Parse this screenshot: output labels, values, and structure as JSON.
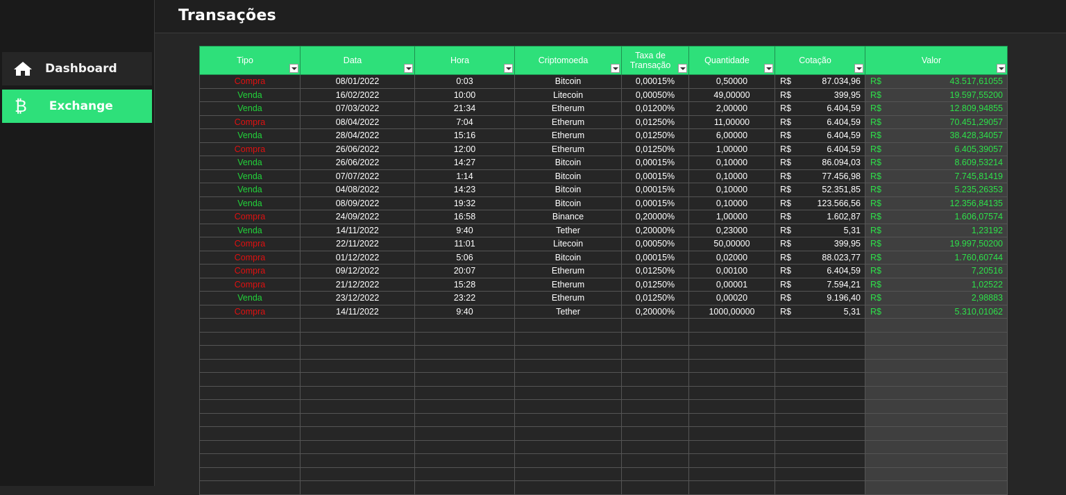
{
  "header": {
    "title": "Transações"
  },
  "sidebar": {
    "items": [
      {
        "label": "Dashboard",
        "icon": "home-icon",
        "active": false
      },
      {
        "label": "Exchange",
        "icon": "bitcoin-icon",
        "active": true
      }
    ]
  },
  "colors": {
    "accent": "#2ee07a",
    "compra": "#e01010",
    "venda": "#22d33a"
  },
  "table": {
    "columns": [
      {
        "key": "tipo",
        "label": "Tipo",
        "filter": true
      },
      {
        "key": "data",
        "label": "Data",
        "filter": true
      },
      {
        "key": "hora",
        "label": "Hora",
        "filter": true
      },
      {
        "key": "cripto",
        "label": "Criptomoeda",
        "filter": true
      },
      {
        "key": "taxa",
        "label": "Taxa de Transação",
        "filter": true
      },
      {
        "key": "qtd",
        "label": "Quantidade",
        "filter": true
      },
      {
        "key": "cotacao",
        "label": "Cotação",
        "filter": true
      },
      {
        "key": "valor",
        "label": "Valor",
        "filter": true
      }
    ],
    "currency": "R$",
    "rows": [
      {
        "tipo": "Compra",
        "data": "08/01/2022",
        "hora": "0:03",
        "cripto": "Bitcoin",
        "taxa": "0,00015%",
        "qtd": "0,50000",
        "cotacao": "87.034,96",
        "valor": "43.517,61055"
      },
      {
        "tipo": "Venda",
        "data": "16/02/2022",
        "hora": "10:00",
        "cripto": "Litecoin",
        "taxa": "0,00050%",
        "qtd": "49,00000",
        "cotacao": "399,95",
        "valor": "19.597,55200"
      },
      {
        "tipo": "Venda",
        "data": "07/03/2022",
        "hora": "21:34",
        "cripto": "Etherum",
        "taxa": "0,01200%",
        "qtd": "2,00000",
        "cotacao": "6.404,59",
        "valor": "12.809,94855"
      },
      {
        "tipo": "Compra",
        "data": "08/04/2022",
        "hora": "7:04",
        "cripto": "Etherum",
        "taxa": "0,01250%",
        "qtd": "11,00000",
        "cotacao": "6.404,59",
        "valor": "70.451,29057"
      },
      {
        "tipo": "Venda",
        "data": "28/04/2022",
        "hora": "15:16",
        "cripto": "Etherum",
        "taxa": "0,01250%",
        "qtd": "6,00000",
        "cotacao": "6.404,59",
        "valor": "38.428,34057"
      },
      {
        "tipo": "Compra",
        "data": "26/06/2022",
        "hora": "12:00",
        "cripto": "Etherum",
        "taxa": "0,01250%",
        "qtd": "1,00000",
        "cotacao": "6.404,59",
        "valor": "6.405,39057"
      },
      {
        "tipo": "Venda",
        "data": "26/06/2022",
        "hora": "14:27",
        "cripto": "Bitcoin",
        "taxa": "0,00015%",
        "qtd": "0,10000",
        "cotacao": "86.094,03",
        "valor": "8.609,53214"
      },
      {
        "tipo": "Venda",
        "data": "07/07/2022",
        "hora": "1:14",
        "cripto": "Bitcoin",
        "taxa": "0,00015%",
        "qtd": "0,10000",
        "cotacao": "77.456,98",
        "valor": "7.745,81419"
      },
      {
        "tipo": "Venda",
        "data": "04/08/2022",
        "hora": "14:23",
        "cripto": "Bitcoin",
        "taxa": "0,00015%",
        "qtd": "0,10000",
        "cotacao": "52.351,85",
        "valor": "5.235,26353"
      },
      {
        "tipo": "Venda",
        "data": "08/09/2022",
        "hora": "19:32",
        "cripto": "Bitcoin",
        "taxa": "0,00015%",
        "qtd": "0,10000",
        "cotacao": "123.566,56",
        "valor": "12.356,84135"
      },
      {
        "tipo": "Compra",
        "data": "24/09/2022",
        "hora": "16:58",
        "cripto": "Binance",
        "taxa": "0,20000%",
        "qtd": "1,00000",
        "cotacao": "1.602,87",
        "valor": "1.606,07574"
      },
      {
        "tipo": "Venda",
        "data": "14/11/2022",
        "hora": "9:40",
        "cripto": "Tether",
        "taxa": "0,20000%",
        "qtd": "0,23000",
        "cotacao": "5,31",
        "valor": "1,23192"
      },
      {
        "tipo": "Compra",
        "data": "22/11/2022",
        "hora": "11:01",
        "cripto": "Litecoin",
        "taxa": "0,00050%",
        "qtd": "50,00000",
        "cotacao": "399,95",
        "valor": "19.997,50200"
      },
      {
        "tipo": "Compra",
        "data": "01/12/2022",
        "hora": "5:06",
        "cripto": "Bitcoin",
        "taxa": "0,00015%",
        "qtd": "0,02000",
        "cotacao": "88.023,77",
        "valor": "1.760,60744"
      },
      {
        "tipo": "Compra",
        "data": "09/12/2022",
        "hora": "20:07",
        "cripto": "Etherum",
        "taxa": "0,01250%",
        "qtd": "0,00100",
        "cotacao": "6.404,59",
        "valor": "7,20516"
      },
      {
        "tipo": "Compra",
        "data": "21/12/2022",
        "hora": "15:28",
        "cripto": "Etherum",
        "taxa": "0,01250%",
        "qtd": "0,00001",
        "cotacao": "7.594,21",
        "valor": "1,02522"
      },
      {
        "tipo": "Venda",
        "data": "23/12/2022",
        "hora": "23:22",
        "cripto": "Etherum",
        "taxa": "0,01250%",
        "qtd": "0,00020",
        "cotacao": "9.196,40",
        "valor": "2,98883"
      },
      {
        "tipo": "Compra",
        "data": "14/11/2022",
        "hora": "9:40",
        "cripto": "Tether",
        "taxa": "0,20000%",
        "qtd": "1000,00000",
        "cotacao": "5,31",
        "valor": "5.310,01062"
      }
    ],
    "empty_rows": 13
  }
}
